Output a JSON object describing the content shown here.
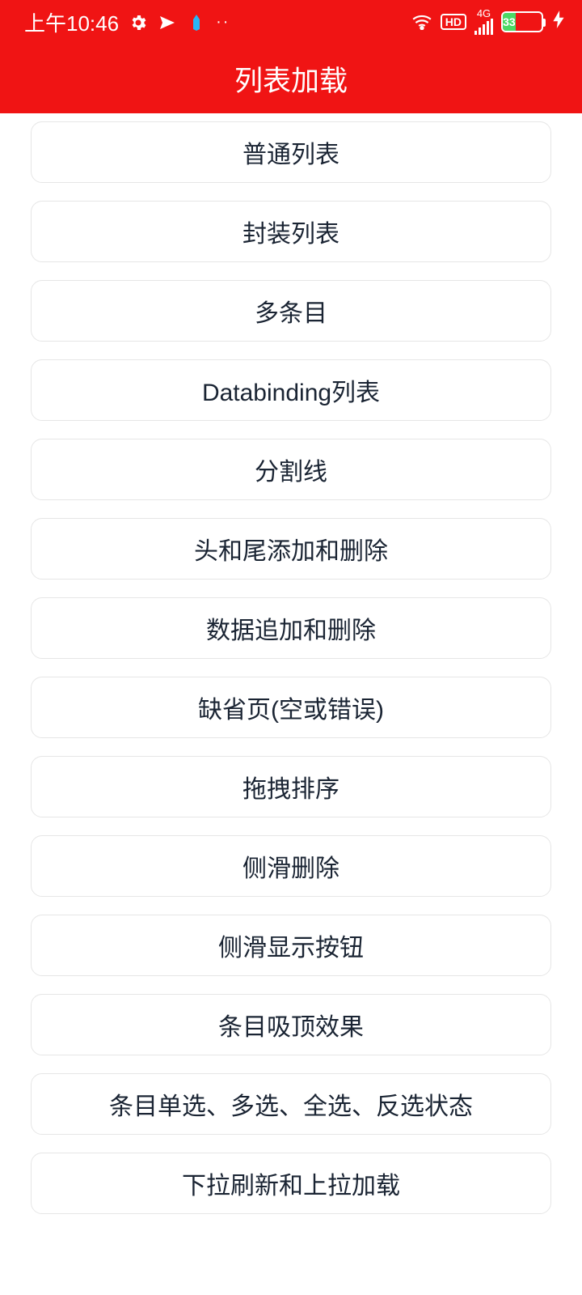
{
  "statusBar": {
    "time": "上午10:46",
    "hdLabel": "HD",
    "netLabel": "4G",
    "batteryPercent": "33",
    "batteryWidthPct": 33
  },
  "header": {
    "title": "列表加载"
  },
  "items": [
    {
      "label": "普通列表"
    },
    {
      "label": "封装列表"
    },
    {
      "label": "多条目"
    },
    {
      "label": "Databinding列表"
    },
    {
      "label": "分割线"
    },
    {
      "label": "头和尾添加和删除"
    },
    {
      "label": "数据追加和删除"
    },
    {
      "label": "缺省页(空或错误)"
    },
    {
      "label": "拖拽排序"
    },
    {
      "label": "侧滑删除"
    },
    {
      "label": "侧滑显示按钮"
    },
    {
      "label": "条目吸顶效果"
    },
    {
      "label": "条目单选、多选、全选、反选状态"
    },
    {
      "label": "下拉刷新和上拉加载"
    }
  ]
}
